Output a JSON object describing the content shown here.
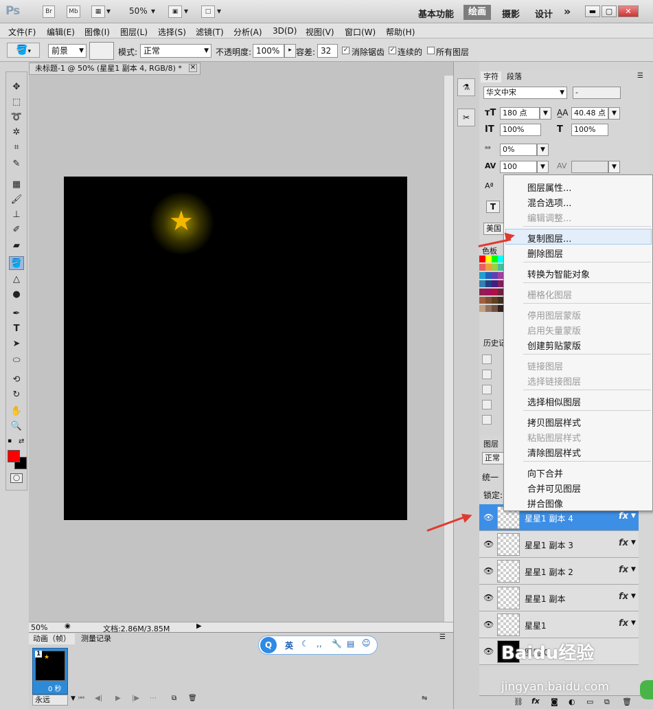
{
  "titlebar": {
    "app": "Ps",
    "btn_br": "Br",
    "btn_mb": "Mb",
    "zoom": "50%",
    "workspaces": [
      "基本功能",
      "绘画",
      "摄影",
      "设计",
      "»"
    ]
  },
  "menubar": {
    "items": [
      "文件(F)",
      "编辑(E)",
      "图像(I)",
      "图层(L)",
      "选择(S)",
      "滤镜(T)",
      "分析(A)",
      "3D(D)",
      "视图(V)",
      "窗口(W)",
      "帮助(H)"
    ]
  },
  "options": {
    "fill_source": "前景",
    "mode_label": "模式:",
    "mode_value": "正常",
    "opacity_label": "不透明度:",
    "opacity_value": "100%",
    "tolerance_label": "容差:",
    "tolerance_value": "32",
    "anti_alias": "消除锯齿",
    "contiguous": "连续的",
    "all_layers": "所有图层"
  },
  "document": {
    "tab_title": "未标题-1 @ 50% (星星1 副本 4, RGB/8) *",
    "zoom": "50%",
    "doc_size": "文档:2.86M/3.85M"
  },
  "animation": {
    "tab_anim": "动画（帧）",
    "tab_measure": "测量记录",
    "frame_number": "1",
    "frame_time": "0 秒",
    "loop": "永远"
  },
  "ime": {
    "lang": "英"
  },
  "character": {
    "tab_char": "字符",
    "tab_para": "段落",
    "font_family": "华文中宋",
    "font_style": "-",
    "font_size": "180 点",
    "leading": "40.48 点",
    "v_scale": "100%",
    "h_scale": "100%",
    "baseline": "0%",
    "tracking": "100",
    "language_prefix": "美国",
    "swatches_tab": "色板",
    "history_tab": "历史记"
  },
  "layers_panel": {
    "tab": "图层",
    "blend": "正常",
    "unify": "统一",
    "lock": "锁定:",
    "layers": [
      {
        "name": "星星1 副本 4",
        "fx": "fx",
        "selected": true
      },
      {
        "name": "星星1 副本 3",
        "fx": "fx",
        "selected": false
      },
      {
        "name": "星星1 副本 2",
        "fx": "fx",
        "selected": false
      },
      {
        "name": "星星1 副本",
        "fx": "fx",
        "selected": false
      },
      {
        "name": "星星1",
        "fx": "fx",
        "selected": false
      },
      {
        "name": "图层 0",
        "fx": "",
        "selected": false
      }
    ]
  },
  "context_menu": {
    "items": [
      {
        "label": "图层属性...",
        "disabled": false
      },
      {
        "label": "混合选项...",
        "disabled": false
      },
      {
        "label": "编辑调整...",
        "disabled": true
      },
      {
        "label": "复制图层...",
        "disabled": false,
        "highlighted": true
      },
      {
        "label": "删除图层",
        "disabled": false
      },
      {
        "label": "转换为智能对象",
        "disabled": false
      },
      {
        "label": "栅格化图层",
        "disabled": true
      },
      {
        "label": "停用图层蒙版",
        "disabled": true
      },
      {
        "label": "启用矢量蒙版",
        "disabled": true
      },
      {
        "label": "创建剪贴蒙版",
        "disabled": false
      },
      {
        "label": "链接图层",
        "disabled": true
      },
      {
        "label": "选择链接图层",
        "disabled": true
      },
      {
        "label": "选择相似图层",
        "disabled": false
      },
      {
        "label": "拷贝图层样式",
        "disabled": false
      },
      {
        "label": "粘贴图层样式",
        "disabled": true
      },
      {
        "label": "清除图层样式",
        "disabled": false
      },
      {
        "label": "向下合并",
        "disabled": false
      },
      {
        "label": "合并可见图层",
        "disabled": false
      },
      {
        "label": "拼合图像",
        "disabled": false
      }
    ]
  },
  "watermark": {
    "brand": "Baidu经验",
    "url": "jingyan.baidu.com"
  },
  "colors": {
    "foreground": "#ff0000",
    "background": "#000000",
    "star": "#f5b800",
    "selection": "#3d8ee5",
    "annotation_arrow": "#e03a30"
  }
}
